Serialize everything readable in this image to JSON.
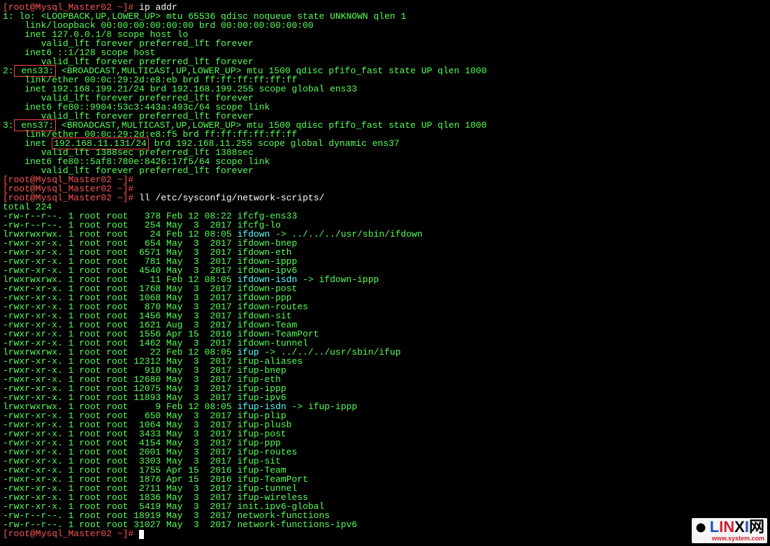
{
  "prompt": "[root@Mysql_Master02 ~]#",
  "cmd1": "ip addr",
  "if1": {
    "hdr_a": "1: lo: <LOOPBACK,UP,LOWER_UP> mtu 65536 qdisc noqueue state UNKNOWN qlen 1",
    "link": "    link/loopback 00:00:00:00:00:00 brd 00:00:00:00:00:00",
    "inet": "    inet 127.0.0.1/8 scope host lo",
    "valid": "       valid_lft forever preferred_lft forever",
    "inet6": "    inet6 ::1/128 scope host",
    "valid2": "       valid_lft forever preferred_lft forever"
  },
  "if2": {
    "num": "2:",
    "name": " ens33:",
    "rest": " <BROADCAST,MULTICAST,UP,LOWER_UP> mtu 1500 qdisc pfifo_fast state UP qlen 1000",
    "link": "    link/ether 00:0c:29:2d:e8:eb brd ff:ff:ff:ff:ff:ff",
    "inet": "    inet 192.168.199.21/24 brd 192.168.199.255 scope global ens33",
    "valid": "       valid_lft forever preferred_lft forever",
    "inet6": "    inet6 fe80::9904:53c3:443a:493c/64 scope link",
    "valid2": "       valid_lft forever preferred_lft forever"
  },
  "if3": {
    "num": "3:",
    "name": " ens37:",
    "rest": " <BROADCAST,MULTICAST,UP,LOWER_UP> mtu 1500 qdisc pfifo_fast state UP qlen 1000",
    "link": "    link/ether 00:0c:29:2d:e8:f5 brd ff:ff:ff:ff:ff:ff",
    "inet_a": "    inet ",
    "inet_ip": "192.168.11.131/24",
    "inet_b": " brd 192.168.11.255 scope global dynamic ens37",
    "valid": "       valid_lft 1388sec preferred_lft 1388sec",
    "inet6": "    inet6 fe80::5af8:780e:8426:17f5/64 scope link",
    "valid2": "       valid_lft forever preferred_lft forever"
  },
  "cmd2": "ll /etc/sysconfig/network-scripts/",
  "total": "total 224",
  "files": [
    {
      "perm": "-rw-r--r--.",
      "n": "1",
      "o": "root",
      "g": "root",
      "s": "  378",
      "d": "Feb 12 08:22",
      "f": "ifcfg-ens33",
      "c": "green"
    },
    {
      "perm": "-rw-r--r--.",
      "n": "1",
      "o": "root",
      "g": "root",
      "s": "  254",
      "d": "May  3  2017",
      "f": "ifcfg-lo",
      "c": "green"
    },
    {
      "perm": "lrwxrwxrwx.",
      "n": "1",
      "o": "root",
      "g": "root",
      "s": "   24",
      "d": "Feb 12 08:05",
      "f": "ifdown",
      "c": "cyan",
      "arrow": " -> ",
      "tgt": "../../../usr/sbin/ifdown",
      "tc": "green"
    },
    {
      "perm": "-rwxr-xr-x.",
      "n": "1",
      "o": "root",
      "g": "root",
      "s": "  654",
      "d": "May  3  2017",
      "f": "ifdown-bnep",
      "c": "green"
    },
    {
      "perm": "-rwxr-xr-x.",
      "n": "1",
      "o": "root",
      "g": "root",
      "s": " 6571",
      "d": "May  3  2017",
      "f": "ifdown-eth",
      "c": "green"
    },
    {
      "perm": "-rwxr-xr-x.",
      "n": "1",
      "o": "root",
      "g": "root",
      "s": "  781",
      "d": "May  3  2017",
      "f": "ifdown-ippp",
      "c": "green"
    },
    {
      "perm": "-rwxr-xr-x.",
      "n": "1",
      "o": "root",
      "g": "root",
      "s": " 4540",
      "d": "May  3  2017",
      "f": "ifdown-ipv6",
      "c": "green"
    },
    {
      "perm": "lrwxrwxrwx.",
      "n": "1",
      "o": "root",
      "g": "root",
      "s": "   11",
      "d": "Feb 12 08:05",
      "f": "ifdown-isdn",
      "c": "cyan",
      "arrow": " -> ",
      "tgt": "ifdown-ippp",
      "tc": "green"
    },
    {
      "perm": "-rwxr-xr-x.",
      "n": "1",
      "o": "root",
      "g": "root",
      "s": " 1768",
      "d": "May  3  2017",
      "f": "ifdown-post",
      "c": "green"
    },
    {
      "perm": "-rwxr-xr-x.",
      "n": "1",
      "o": "root",
      "g": "root",
      "s": " 1068",
      "d": "May  3  2017",
      "f": "ifdown-ppp",
      "c": "green"
    },
    {
      "perm": "-rwxr-xr-x.",
      "n": "1",
      "o": "root",
      "g": "root",
      "s": "  870",
      "d": "May  3  2017",
      "f": "ifdown-routes",
      "c": "green"
    },
    {
      "perm": "-rwxr-xr-x.",
      "n": "1",
      "o": "root",
      "g": "root",
      "s": " 1456",
      "d": "May  3  2017",
      "f": "ifdown-sit",
      "c": "green"
    },
    {
      "perm": "-rwxr-xr-x.",
      "n": "1",
      "o": "root",
      "g": "root",
      "s": " 1621",
      "d": "Aug  3  2017",
      "f": "ifdown-Team",
      "c": "green"
    },
    {
      "perm": "-rwxr-xr-x.",
      "n": "1",
      "o": "root",
      "g": "root",
      "s": " 1556",
      "d": "Apr 15  2016",
      "f": "ifdown-TeamPort",
      "c": "green"
    },
    {
      "perm": "-rwxr-xr-x.",
      "n": "1",
      "o": "root",
      "g": "root",
      "s": " 1462",
      "d": "May  3  2017",
      "f": "ifdown-tunnel",
      "c": "green"
    },
    {
      "perm": "lrwxrwxrwx.",
      "n": "1",
      "o": "root",
      "g": "root",
      "s": "   22",
      "d": "Feb 12 08:05",
      "f": "ifup",
      "c": "cyan",
      "arrow": " -> ",
      "tgt": "../../../usr/sbin/ifup",
      "tc": "green"
    },
    {
      "perm": "-rwxr-xr-x.",
      "n": "1",
      "o": "root",
      "g": "root",
      "s": "12312",
      "d": "May  3  2017",
      "f": "ifup-aliases",
      "c": "green"
    },
    {
      "perm": "-rwxr-xr-x.",
      "n": "1",
      "o": "root",
      "g": "root",
      "s": "  910",
      "d": "May  3  2017",
      "f": "ifup-bnep",
      "c": "green"
    },
    {
      "perm": "-rwxr-xr-x.",
      "n": "1",
      "o": "root",
      "g": "root",
      "s": "12680",
      "d": "May  3  2017",
      "f": "ifup-eth",
      "c": "green"
    },
    {
      "perm": "-rwxr-xr-x.",
      "n": "1",
      "o": "root",
      "g": "root",
      "s": "12075",
      "d": "May  3  2017",
      "f": "ifup-ippp",
      "c": "green"
    },
    {
      "perm": "-rwxr-xr-x.",
      "n": "1",
      "o": "root",
      "g": "root",
      "s": "11893",
      "d": "May  3  2017",
      "f": "ifup-ipv6",
      "c": "green"
    },
    {
      "perm": "lrwxrwxrwx.",
      "n": "1",
      "o": "root",
      "g": "root",
      "s": "    9",
      "d": "Feb 12 08:05",
      "f": "ifup-isdn",
      "c": "cyan",
      "arrow": " -> ",
      "tgt": "ifup-ippp",
      "tc": "green"
    },
    {
      "perm": "-rwxr-xr-x.",
      "n": "1",
      "o": "root",
      "g": "root",
      "s": "  650",
      "d": "May  3  2017",
      "f": "ifup-plip",
      "c": "green"
    },
    {
      "perm": "-rwxr-xr-x.",
      "n": "1",
      "o": "root",
      "g": "root",
      "s": " 1064",
      "d": "May  3  2017",
      "f": "ifup-plusb",
      "c": "green"
    },
    {
      "perm": "-rwxr-xr-x.",
      "n": "1",
      "o": "root",
      "g": "root",
      "s": " 3433",
      "d": "May  3  2017",
      "f": "ifup-post",
      "c": "green"
    },
    {
      "perm": "-rwxr-xr-x.",
      "n": "1",
      "o": "root",
      "g": "root",
      "s": " 4154",
      "d": "May  3  2017",
      "f": "ifup-ppp",
      "c": "green"
    },
    {
      "perm": "-rwxr-xr-x.",
      "n": "1",
      "o": "root",
      "g": "root",
      "s": " 2001",
      "d": "May  3  2017",
      "f": "ifup-routes",
      "c": "green"
    },
    {
      "perm": "-rwxr-xr-x.",
      "n": "1",
      "o": "root",
      "g": "root",
      "s": " 3303",
      "d": "May  3  2017",
      "f": "ifup-sit",
      "c": "green"
    },
    {
      "perm": "-rwxr-xr-x.",
      "n": "1",
      "o": "root",
      "g": "root",
      "s": " 1755",
      "d": "Apr 15  2016",
      "f": "ifup-Team",
      "c": "green"
    },
    {
      "perm": "-rwxr-xr-x.",
      "n": "1",
      "o": "root",
      "g": "root",
      "s": " 1876",
      "d": "Apr 15  2016",
      "f": "ifup-TeamPort",
      "c": "green"
    },
    {
      "perm": "-rwxr-xr-x.",
      "n": "1",
      "o": "root",
      "g": "root",
      "s": " 2711",
      "d": "May  3  2017",
      "f": "ifup-tunnel",
      "c": "green"
    },
    {
      "perm": "-rwxr-xr-x.",
      "n": "1",
      "o": "root",
      "g": "root",
      "s": " 1836",
      "d": "May  3  2017",
      "f": "ifup-wireless",
      "c": "green"
    },
    {
      "perm": "-rwxr-xr-x.",
      "n": "1",
      "o": "root",
      "g": "root",
      "s": " 5419",
      "d": "May  3  2017",
      "f": "init.ipv6-global",
      "c": "green"
    },
    {
      "perm": "-rw-r--r--.",
      "n": "1",
      "o": "root",
      "g": "root",
      "s": "18919",
      "d": "May  3  2017",
      "f": "network-functions",
      "c": "green"
    },
    {
      "perm": "-rw-r--r--.",
      "n": "1",
      "o": "root",
      "g": "root",
      "s": "31027",
      "d": "May  3  2017",
      "f": "network-functions-ipv6",
      "c": "green"
    }
  ],
  "logo": {
    "l": "L",
    "in": "IN",
    "x": "X",
    "i": "I",
    "wang": "网",
    "sub": "www.system.com"
  }
}
